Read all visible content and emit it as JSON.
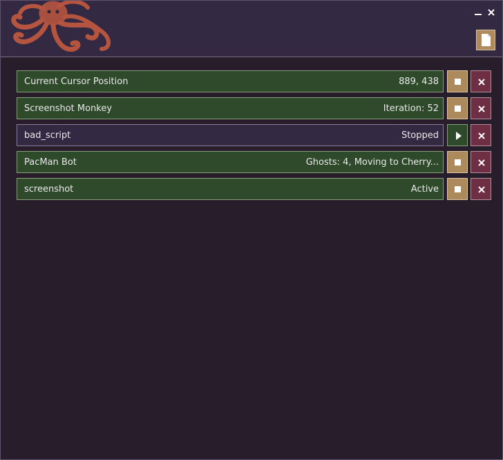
{
  "header": {
    "logo_icon": "octopus-logo",
    "minimize_icon": "minimize-icon",
    "close_icon": "close-icon",
    "new_script_icon": "document-icon"
  },
  "colors": {
    "background": "#271d2b",
    "header": "#332942",
    "running_row": "#2e4a2a",
    "stopped_row": "#332942",
    "stop_button": "#ad8a5b",
    "remove_button": "#6e2f45",
    "octopus": "#b5543f"
  },
  "scripts": [
    {
      "name": "Current Cursor Position",
      "status": "889, 438",
      "running": true
    },
    {
      "name": "Screenshot Monkey",
      "status": "Iteration: 52",
      "running": true
    },
    {
      "name": "bad_script",
      "status": "Stopped",
      "running": false
    },
    {
      "name": "PacMan Bot",
      "status": "Ghosts: 4, Moving to Cherry...",
      "running": true
    },
    {
      "name": "screenshot",
      "status": "Active",
      "running": true
    }
  ]
}
